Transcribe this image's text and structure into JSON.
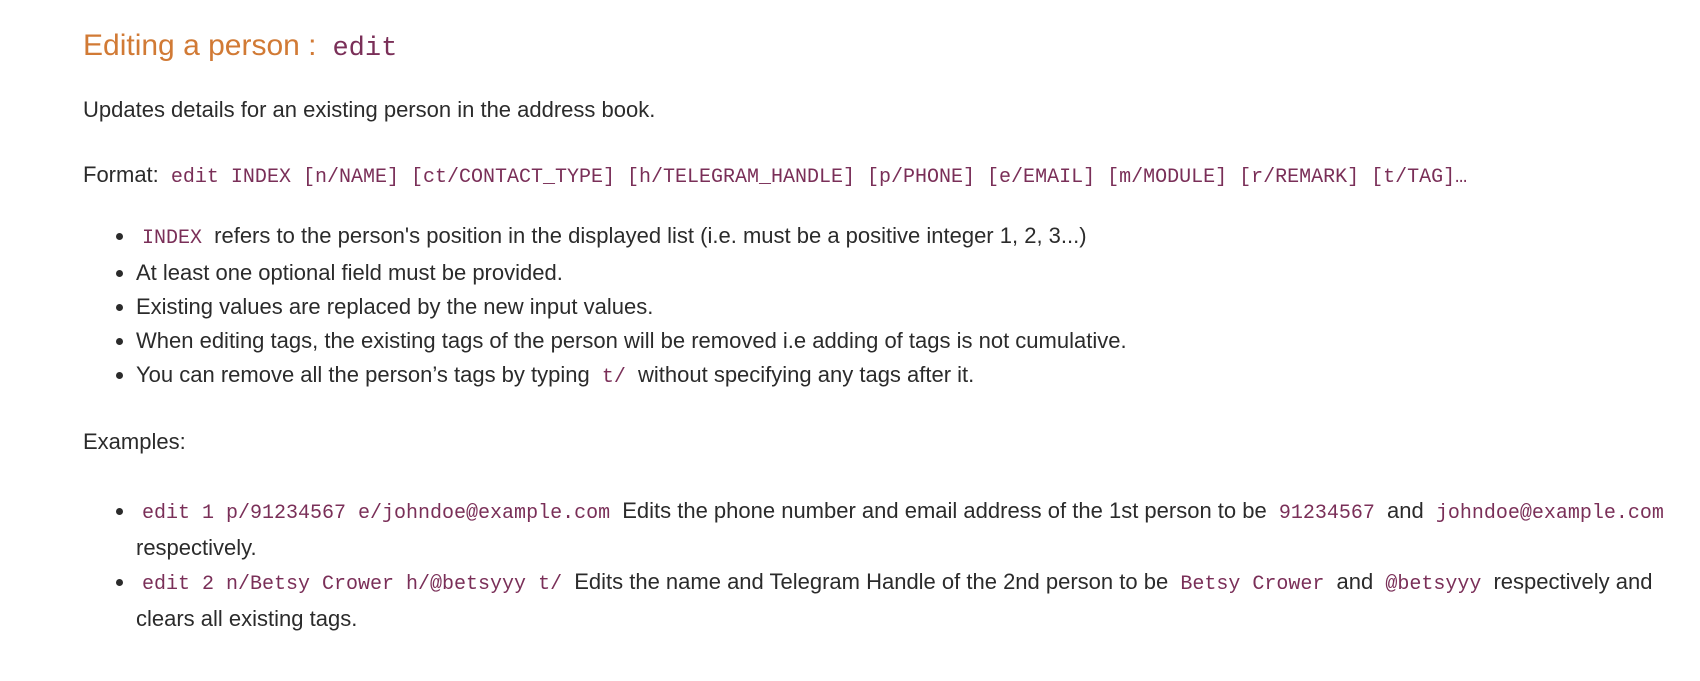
{
  "section": {
    "title": "Editing a person :",
    "command": "edit"
  },
  "description": "Updates details for an existing person in the address book.",
  "format": {
    "label": "Format:",
    "syntax": "edit INDEX [n/NAME] [ct/CONTACT_TYPE] [h/TELEGRAM_HANDLE] [p/PHONE] [e/EMAIL] [m/MODULE] [r/REMARK] [t/TAG]…"
  },
  "notes": {
    "index_code": "INDEX",
    "index_text": "refers to the person's position in the displayed list (i.e. must be a positive integer 1, 2, 3...)",
    "optional": "At least one optional field must be provided.",
    "replaced": "Existing values are replaced by the new input values.",
    "tags": "When editing tags, the existing tags of the person will be removed i.e adding of tags is not cumulative.",
    "remove_pre": "You can remove all the person’s tags by typing",
    "remove_code": "t/",
    "remove_post": "without specifying any tags after it."
  },
  "examples": {
    "label": "Examples:",
    "ex1": {
      "cmd": "edit 1 p/91234567 e/johndoe@example.com",
      "text1": "Edits the phone number and email address of the 1st person to be",
      "phone": "91234567",
      "and": "and",
      "email": "johndoe@example.com",
      "text2": "respectively."
    },
    "ex2": {
      "cmd": "edit 2 n/Betsy Crower h/@betsyyy t/",
      "text1": "Edits the name and Telegram Handle of the 2nd person to be",
      "name": "Betsy Crower",
      "and": "and",
      "handle": "@betsyyy",
      "text2": "respectively and clears all existing tags."
    }
  }
}
